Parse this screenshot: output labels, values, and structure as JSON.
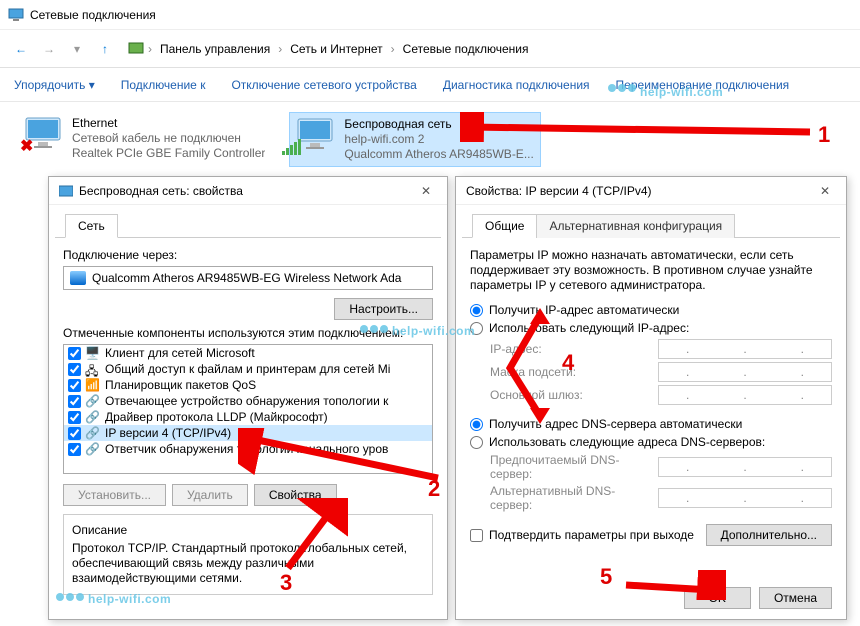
{
  "window": {
    "title": "Сетевые подключения"
  },
  "breadcrumb": {
    "root": "Панель управления",
    "mid": "Сеть и Интернет",
    "leaf": "Сетевые подключения"
  },
  "toolbar": {
    "organize": "Упорядочить ▾",
    "connect": "Подключение к",
    "disable": "Отключение сетевого устройства",
    "diagnose": "Диагностика подключения",
    "rename": "Переименование подключения"
  },
  "connections": {
    "ethernet": {
      "name": "Ethernet",
      "status": "Сетевой кабель не подключен",
      "device": "Realtek PCIe GBE Family Controller"
    },
    "wifi": {
      "name": "Беспроводная сеть",
      "status": "help-wifi.com  2",
      "device": "Qualcomm Atheros AR9485WB-E..."
    }
  },
  "dlg1": {
    "title": "Беспроводная сеть: свойства",
    "tab": "Сеть",
    "connect_via": "Подключение через:",
    "adapter": "Qualcomm Atheros AR9485WB-EG Wireless Network Ada",
    "configure": "Настроить...",
    "components_label": "Отмеченные компоненты используются этим подключением:",
    "items": [
      "Клиент для сетей Microsoft",
      "Общий доступ к файлам и принтерам для сетей Mi",
      "Планировщик пакетов QoS",
      "Отвечающее устройство обнаружения топологии к",
      "Драйвер протокола LLDP (Майкрософт)",
      "IP версии 4 (TCP/IPv4)",
      "Ответчик обнаружения топологии канального уров"
    ],
    "install": "Установить...",
    "remove": "Удалить",
    "properties": "Свойства",
    "desc_title": "Описание",
    "desc": "Протокол TCP/IP. Стандартный протокол глобальных сетей, обеспечивающий связь между различными взаимодействующими сетями."
  },
  "dlg2": {
    "title": "Свойства: IP версии 4 (TCP/IPv4)",
    "tab_general": "Общие",
    "tab_alt": "Альтернативная конфигурация",
    "intro": "Параметры IP можно назначать автоматически, если сеть поддерживает эту возможность. В противном случае узнайте параметры IP у сетевого администратора.",
    "r_ip_auto": "Получить IP-адрес автоматически",
    "r_ip_manual": "Использовать следующий IP-адрес:",
    "ip_addr": "IP-адрес:",
    "mask": "Маска подсети:",
    "gw": "Основной шлюз:",
    "r_dns_auto": "Получить адрес DNS-сервера автоматически",
    "r_dns_manual": "Использовать следующие адреса DNS-серверов:",
    "dns1": "Предпочитаемый DNS-сервер:",
    "dns2": "Альтернативный DNS-сервер:",
    "confirm": "Подтвердить параметры при выходе",
    "advanced": "Дополнительно...",
    "ok": "OK",
    "cancel": "Отмена"
  },
  "watermark": "help-wifi.com",
  "annotations": {
    "n1": "1",
    "n2": "2",
    "n3": "3",
    "n4": "4",
    "n5": "5"
  }
}
